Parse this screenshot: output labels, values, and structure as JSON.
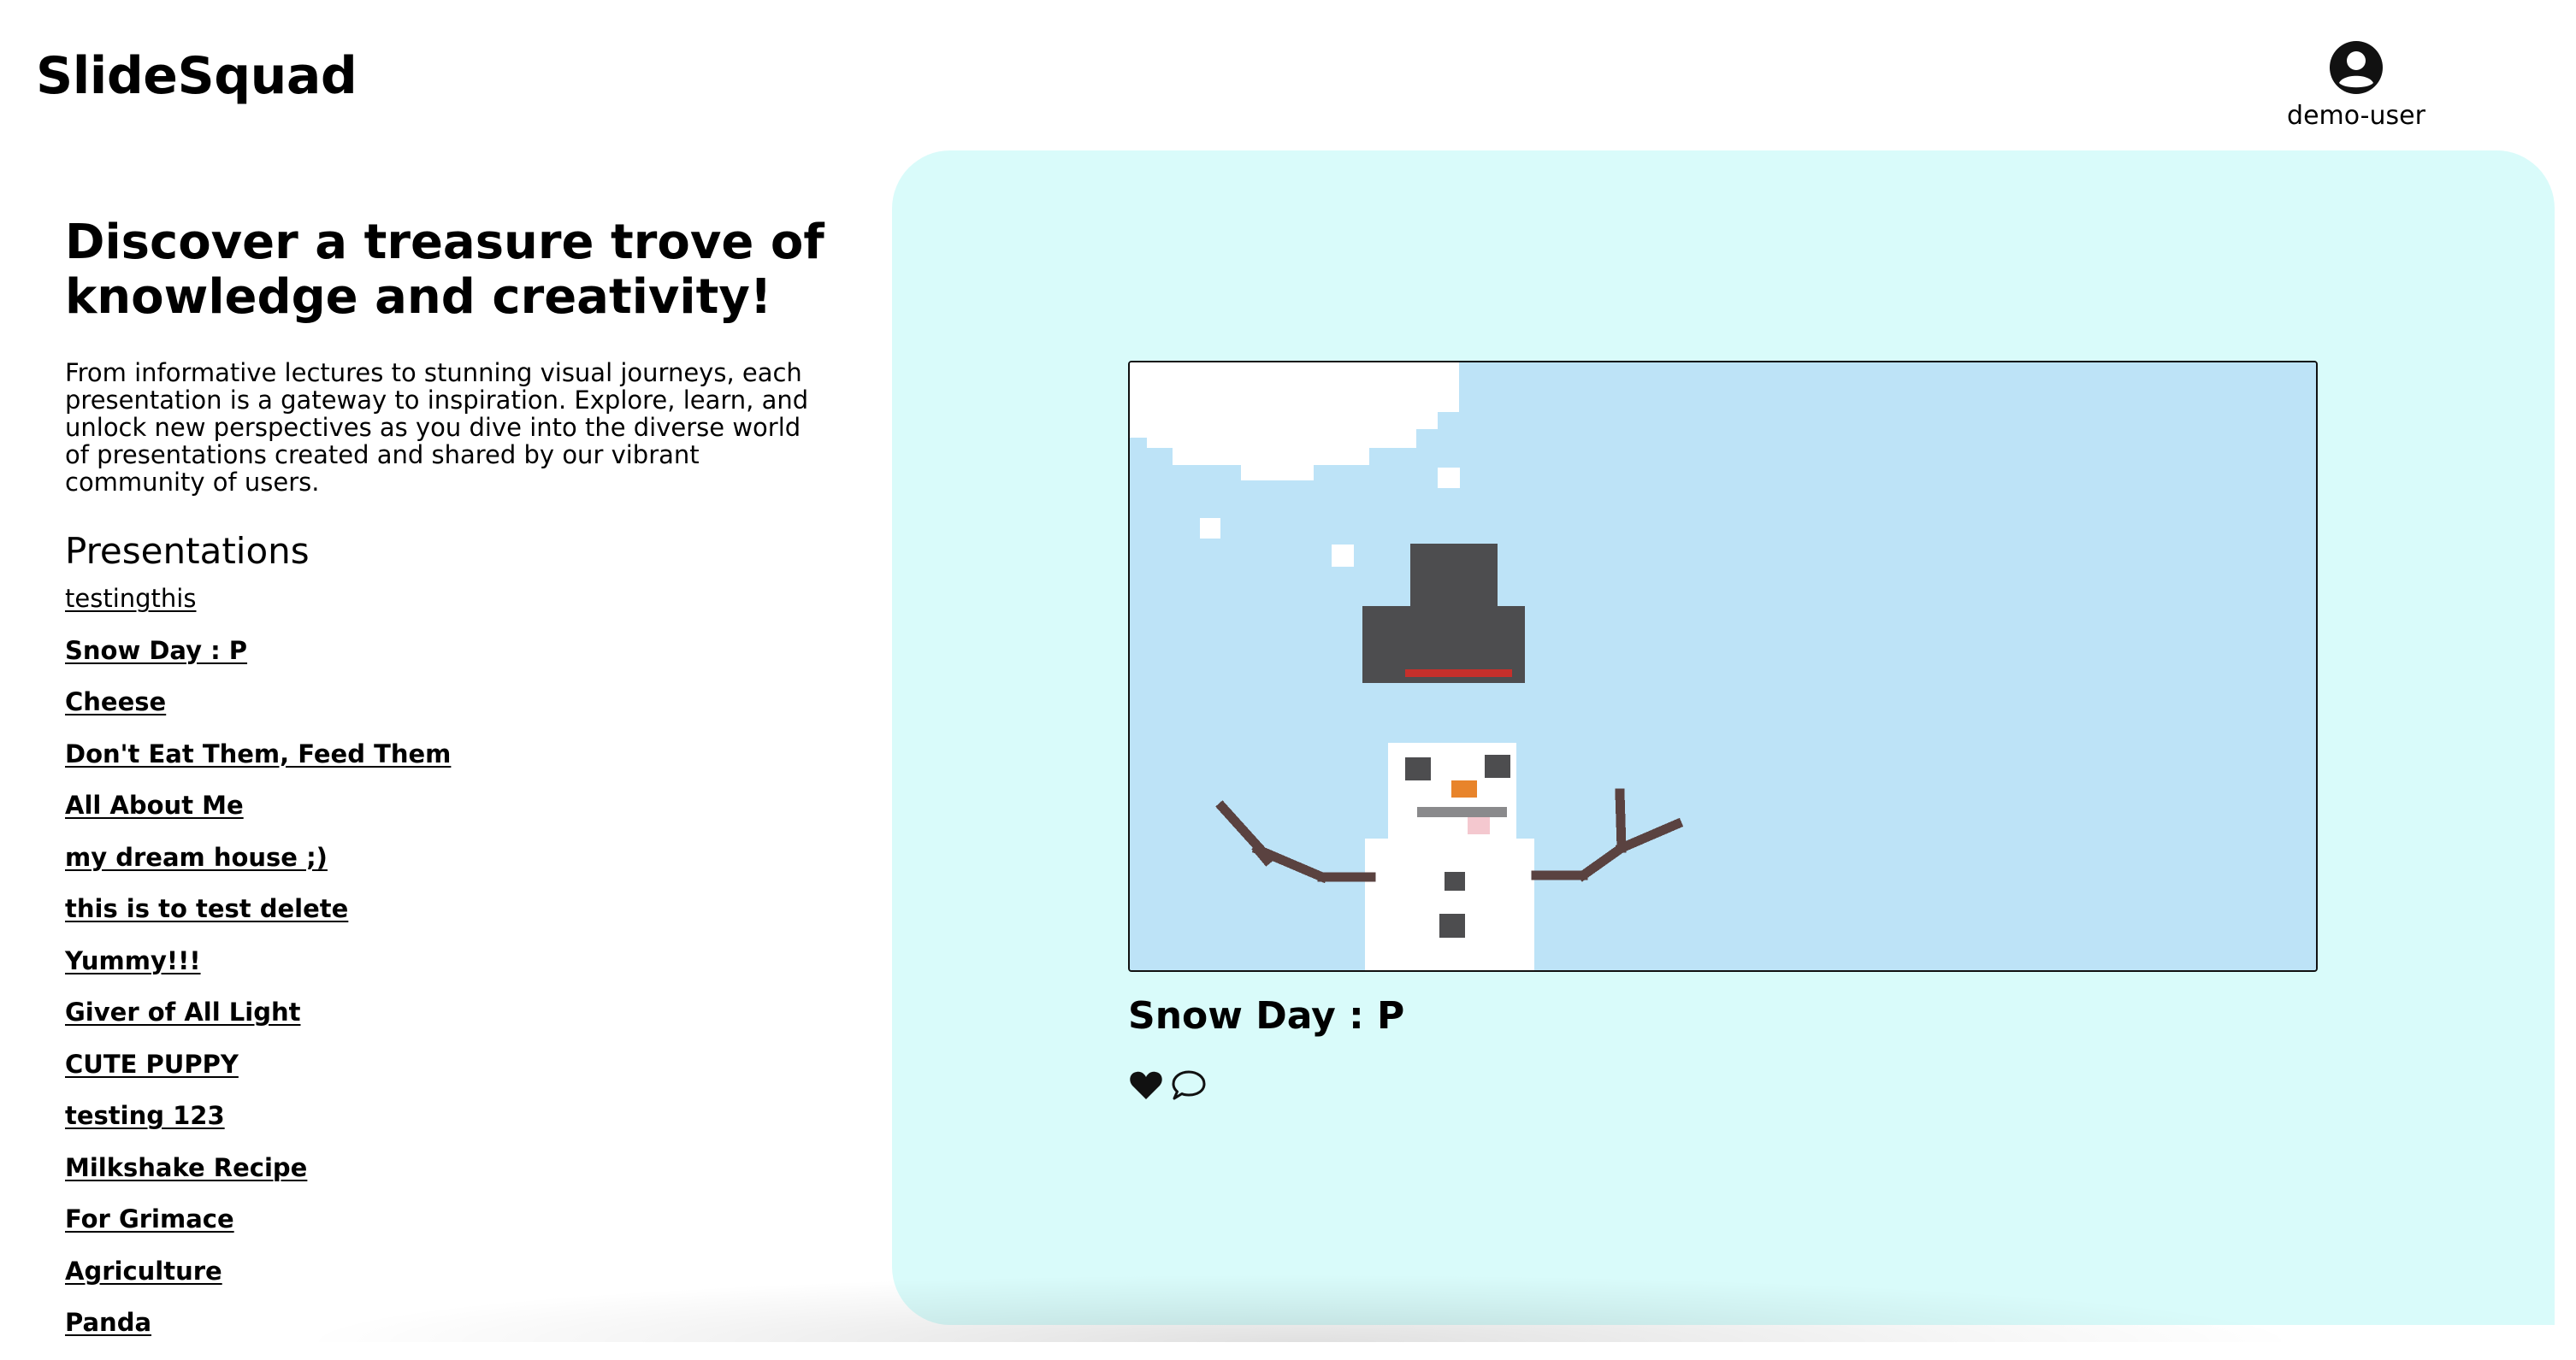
{
  "app": {
    "logo": "SlideSquad"
  },
  "user": {
    "name": "demo-user",
    "icon": "user-circle-icon"
  },
  "hero": {
    "headline": "Discover a treasure trove of knowledge and creativity!",
    "description": "From informative lectures to stunning visual journeys, each presentation is a gateway to inspiration. Explore, learn, and unlock new perspectives as you dive into the diverse world of presentations created and shared by our vibrant community of users."
  },
  "presentations": {
    "heading": "Presentations",
    "items": [
      "testingthis",
      "Snow Day : P",
      "Cheese",
      "Don't Eat Them, Feed Them",
      "All About Me",
      "my dream house ;)",
      "this is to test delete",
      "Yummy!!!",
      "Giver of All Light",
      "CUTE PUPPY",
      "testing 123",
      "Milkshake Recipe",
      "For Grimace",
      "Agriculture",
      "Panda"
    ]
  },
  "featured": {
    "title": "Snow Day : P",
    "slide_image": "pixel-art-snowman-slide",
    "actions": {
      "like_icon": "heart-icon",
      "comment_icon": "comment-icon"
    }
  },
  "colors": {
    "panel_bg": "#d9fbfa",
    "sky": "#bde3f7"
  }
}
